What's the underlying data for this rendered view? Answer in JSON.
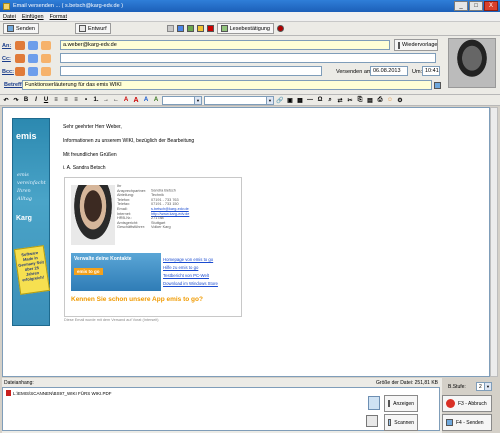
{
  "window": {
    "title": "Email versenden ... ( s.betsch@karg-edv.de )",
    "minimize": "_",
    "maximize": "□",
    "close": "X"
  },
  "menu": [
    "Datei",
    "Einfügen",
    "Format"
  ],
  "toolbar": {
    "send": "Senden",
    "draft": "Entwurf",
    "read_receipt": "Lesebestätigung"
  },
  "header": {
    "to_label": "An:",
    "to_value": "a.weber@karg-edv.de",
    "cc_label": "Cc:",
    "cc_value": "",
    "bcc_label": "Bcc:",
    "bcc_value": "",
    "subject_label": "Betreff:",
    "subject_value": "Funktionserläuterung für das emis WIKI",
    "template_button": "Wiedervorlage",
    "send_at_label": "Versenden am:",
    "send_date": "06.08.2013",
    "send_time_label": "Um:",
    "send_time": "10:41"
  },
  "format": {
    "size_value": ""
  },
  "mail": {
    "greeting": "Sehr geehrter Herr Weber,",
    "body": "Informationen zu unserem WIKI, bezüglich der Bearbeitung",
    "closing": "Mit freundlichen Grüßen",
    "signature": "i. A. Sandra Betsch",
    "footer_note": "Diese Email wurde mit dem Versand auf Vorat (Interseit)"
  },
  "signature_card": {
    "rows": [
      [
        "Ihr Ansprechpartner:",
        "Sandra Betsch"
      ],
      [
        "Abteilung:",
        "Technik"
      ],
      [
        "Telefon:",
        "07191 - 733 763"
      ],
      [
        "Telefax:",
        "07191 - 733 150"
      ],
      [
        "Email:",
        "s.betsch@karg-edv.de"
      ],
      [
        "Internet:",
        "http://www.karg-edv.de"
      ],
      [
        "HRB-Nr.:",
        "271788"
      ],
      [
        "Amtsgericht:",
        "Stuttgart"
      ],
      [
        "Geschäftsführer:",
        "Volker Karg"
      ]
    ],
    "promo_title": "Verwalte deine Kontakte",
    "promo_badge": "emis to go",
    "links": [
      "Homepage von emis to go",
      "Hilfe zu emis to go",
      "Testbericht von PC-Welt",
      "Download im Windows Store"
    ],
    "app_line": "Kennen Sie schon unsere App emis to go?"
  },
  "banner": {
    "logo": "emis",
    "handwriting": "emis vereinfacht Ihren Alltag",
    "sticker": "Software Made in Germany Seit über 25 Jahren erfolgreich!",
    "brand": "Karg"
  },
  "attachments": {
    "caption": "Dateianhang:",
    "total_size": "Größe der Datei: 251,81 KB",
    "files": [
      "L:\\EMIS\\SCANNEN\\BS97_WIKI FÜRS WIKI.PDF"
    ]
  },
  "footer": {
    "stage_label": "B.Stufe:",
    "stage_value": "2",
    "show_button": "Anzeigen",
    "scan_button": "Scannen",
    "cancel_button": "F3 - Abbruch",
    "send_button": "F4 - Senden"
  },
  "colors": {
    "accent": "#2f7ed8",
    "link": "#1a4bd0",
    "promo": "#f09a00"
  }
}
